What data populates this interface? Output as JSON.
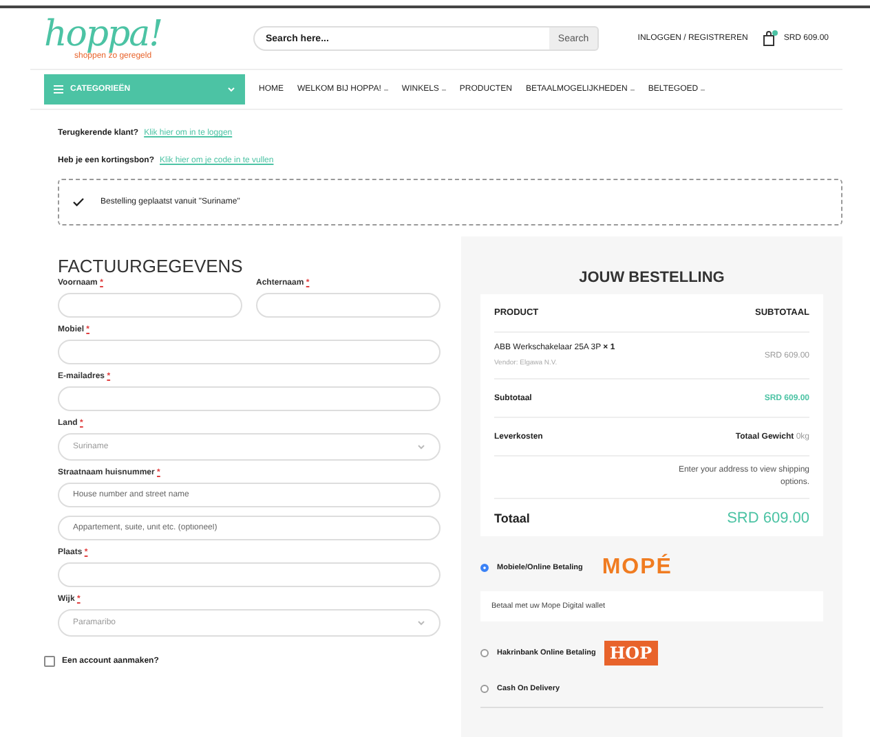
{
  "header": {
    "logo": {
      "name": "hoppa!",
      "tagline": "shoppen zo geregeld"
    },
    "search": {
      "placeholder": "Search here...",
      "button": "Search"
    },
    "account_link": "INLOGGEN / REGISTREREN",
    "cart": {
      "total": "SRD 609.00"
    }
  },
  "nav": {
    "categories_button": "CATEGORIEËN",
    "items": [
      {
        "label": "HOME",
        "dropdown": false
      },
      {
        "label": "WELKOM BIJ HOPPA!",
        "dropdown": true
      },
      {
        "label": "WINKELS",
        "dropdown": true
      },
      {
        "label": "PRODUCTEN",
        "dropdown": false
      },
      {
        "label": "BETAALMOGELIJKHEDEN",
        "dropdown": true
      },
      {
        "label": "BELTEGOED",
        "dropdown": true
      }
    ]
  },
  "notices": [
    {
      "text": "Terugkerende klant?",
      "link": "Klik hier om in te loggen"
    },
    {
      "text": "Heb je een kortingsbon?",
      "link": "Klik hier om je code in te vullen"
    }
  ],
  "message": "Bestelling geplaatst vanuit \"Suriname\"",
  "billing": {
    "title": "FACTUURGEGEVENS",
    "rows": [
      [
        {
          "kind": "text",
          "label": "Voornaam",
          "required_mark": "*"
        },
        {
          "kind": "text",
          "label": "Achternaam",
          "required_mark": "*"
        }
      ],
      [
        {
          "kind": "text",
          "label": "Mobiel",
          "required_mark": "*"
        }
      ],
      [
        {
          "kind": "text",
          "label": "E-mailadres",
          "required_mark": "*"
        }
      ],
      [
        {
          "kind": "select",
          "label": "Land",
          "required_mark": "*",
          "value": "Suriname"
        }
      ],
      [
        {
          "kind": "text",
          "label": "Straatnaam huisnummer",
          "required_mark": "*",
          "placeholder": "House number and street name"
        }
      ],
      [
        {
          "kind": "text",
          "placeholder": "Appartement, suite, unit etc. (optioneel)"
        }
      ],
      [
        {
          "kind": "text",
          "label": "Plaats",
          "required_mark": "*"
        }
      ],
      [
        {
          "kind": "select",
          "label": "Wijk",
          "required_mark": "*",
          "value": "Paramaribo"
        }
      ]
    ],
    "create_account": {
      "label": "Een account aanmaken?",
      "checked": false
    }
  },
  "order": {
    "title": "JOUW BESTELLING",
    "columns": [
      "PRODUCT",
      "SUBTOTAAL"
    ],
    "items": [
      {
        "name": "ABB Werkschakelaar 25A 3P",
        "quantity": "× 1",
        "vendor": "Vendor: Elgawa N.V.",
        "price": "SRD 609.00"
      }
    ],
    "subtotal": {
      "label": "Subtotaal",
      "value": "SRD 609.00"
    },
    "shipping": {
      "label": "Leverkosten",
      "weight_label": "Totaal Gewicht",
      "weight": "0kg",
      "note": "Enter your address to view shipping options."
    },
    "total": {
      "label": "Totaal",
      "value": "SRD 609.00"
    }
  },
  "payment_methods": [
    {
      "label": "Mobiele/Online Betaling",
      "logo": {
        "kind": "wordmark",
        "text": "MOPÉ"
      },
      "selected": true,
      "description": "Betaal met uw Mope Digital wallet"
    },
    {
      "label": "Hakrinbank Online Betaling",
      "logo": {
        "kind": "badge",
        "text": "HOP"
      },
      "selected": false
    },
    {
      "label": "Cash On Delivery",
      "selected": false
    }
  ]
}
